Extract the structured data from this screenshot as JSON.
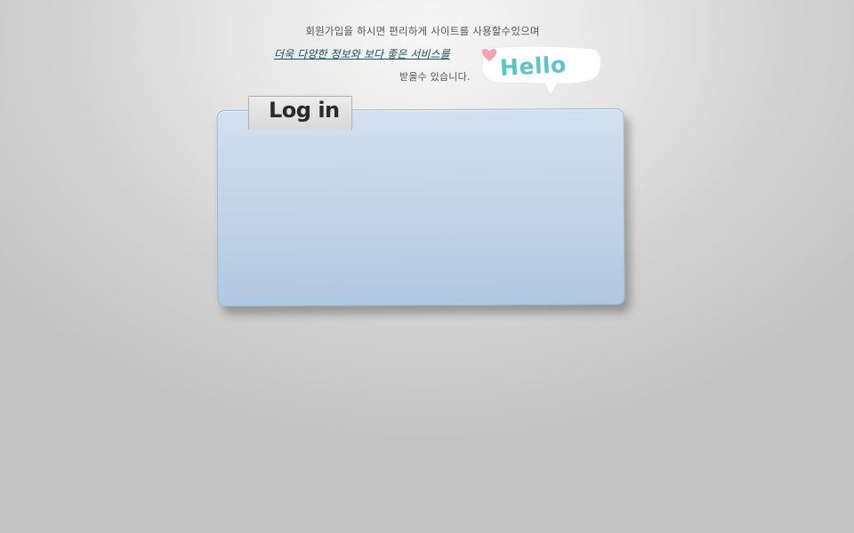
{
  "intro": {
    "line1": "회원가입을 하시면 편리하게 사이트를 사용할수있으며",
    "link": "더욱 다양한 정보와 보다 좋은 서비스를",
    "line3": "받을수 있습니다."
  },
  "hello_bubble": {
    "text": "Hello",
    "icon": "heart-icon"
  },
  "login": {
    "title": "Log in"
  },
  "colors": {
    "hello_text": "#5cc4c9",
    "heart": "#f5a3b2",
    "panel_top": "#d3e0ee",
    "panel_bottom": "#b1c8e1",
    "link": "#1f4f55"
  }
}
